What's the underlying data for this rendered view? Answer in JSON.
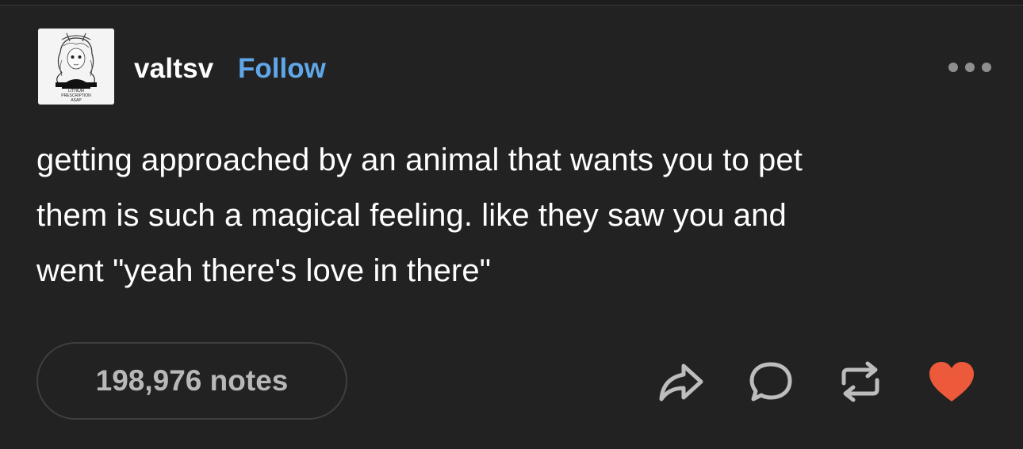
{
  "post": {
    "author": {
      "username": "valtsv",
      "follow_label": "Follow",
      "avatar_text": [
        "LITHIUM",
        "PRESCRIPTION",
        "ASAP"
      ]
    },
    "menu_icon": "more-options-icon",
    "text": "getting approached by an animal that wants you to pet\nthem is such a magical feeling. like they saw you and\nwent \"yeah there's love in there\"",
    "notes_label": "198,976 notes",
    "actions": [
      {
        "name": "share",
        "icon": "share-icon"
      },
      {
        "name": "reply",
        "icon": "reply-icon"
      },
      {
        "name": "reblog",
        "icon": "reblog-icon"
      },
      {
        "name": "like",
        "icon": "heart-icon",
        "active": true
      }
    ]
  },
  "colors": {
    "background": "#222222",
    "text": "#ffffff",
    "follow": "#5fa7e8",
    "muted": "#b8b8b8",
    "heart": "#ec5a3b"
  }
}
